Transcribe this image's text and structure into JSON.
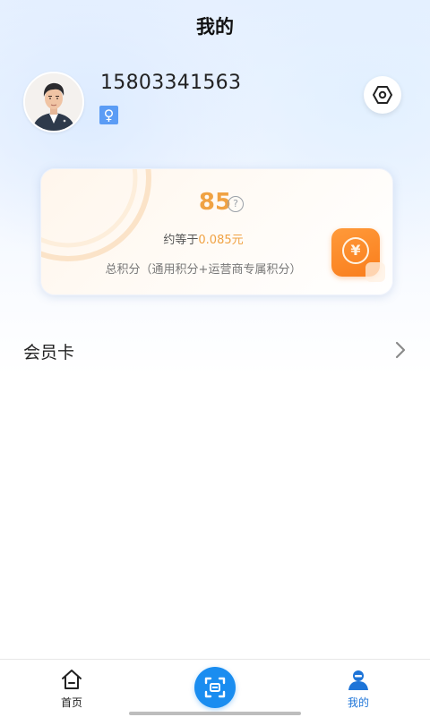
{
  "header": {
    "title": "我的"
  },
  "profile": {
    "phone": "15803341563",
    "avatar_icon": "avatar-man-icon",
    "gender_icon": "female-symbol-icon",
    "gender_symbol": "♀",
    "settings_icon": "settings-icon"
  },
  "points": {
    "value": "85",
    "help_symbol": "?",
    "equiv_prefix": "约等于",
    "equiv_amount": "0.085元",
    "total_label": "总积分（通用积分+运营商专属积分）",
    "coin_symbol": "¥",
    "accent_color": "#f0a243"
  },
  "member": {
    "label": "会员卡",
    "chevron_icon": "chevron-right-icon"
  },
  "nav": {
    "items": [
      {
        "label": "首页",
        "icon": "home-icon"
      },
      {
        "label": "我的",
        "icon": "user-icon"
      }
    ],
    "scan_icon": "scan-icon",
    "active_color": "#1d74d8"
  }
}
